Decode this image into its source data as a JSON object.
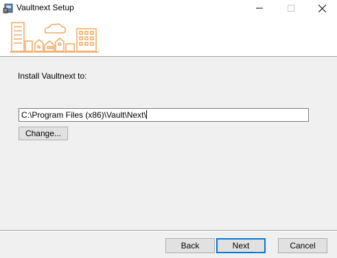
{
  "window": {
    "title": "Vaultnext Setup",
    "icons": {
      "app": "installer-icon",
      "minimize": "minimize-icon",
      "maximize": "maximize-icon",
      "close": "close-icon"
    }
  },
  "banner": {
    "art": "city-skyline-logo",
    "accent_color": "#f3a65c"
  },
  "main": {
    "install_label": "Install Vaultnext to:",
    "path_value": "C:\\Program Files (x86)\\Vault\\Next\\",
    "change_label": "Change..."
  },
  "footer": {
    "back_label": "Back",
    "next_label": "Next",
    "cancel_label": "Cancel"
  }
}
